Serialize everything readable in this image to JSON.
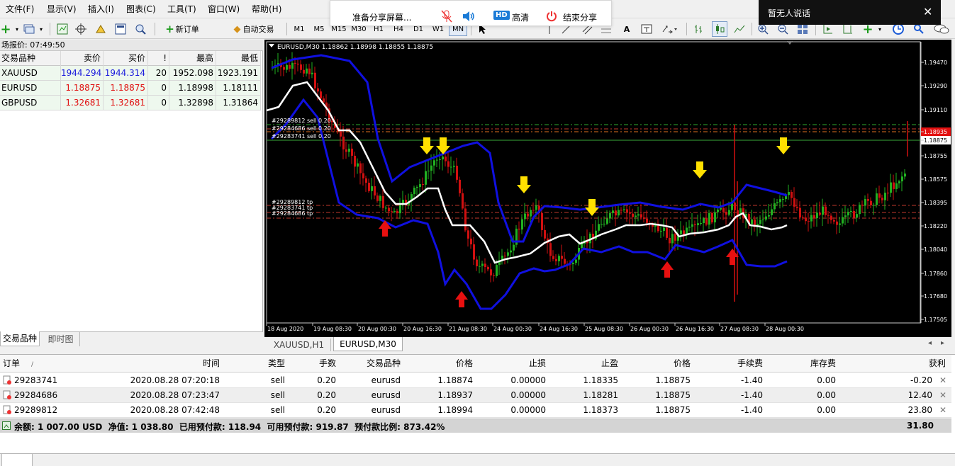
{
  "menu": {
    "file": "文件(F)",
    "view": "显示(V)",
    "insert": "插入(I)",
    "charts": "图表(C)",
    "tools": "工具(T)",
    "window": "窗口(W)",
    "help": "帮助(H)"
  },
  "toolbar": {
    "new_order": "新订单",
    "auto_trading": "自动交易",
    "timeframes": [
      "M1",
      "M5",
      "M15",
      "M30",
      "H1",
      "H4",
      "D1",
      "W1",
      "MN"
    ],
    "text_tool": "A"
  },
  "share_bar": {
    "preparing": "准备分享屏幕...",
    "hd": "HD",
    "hd_label": "高清",
    "end_share": "结束分享"
  },
  "notice": {
    "text": "暂无人说话",
    "close": "✕"
  },
  "market_watch": {
    "title": "场报价: 07:49:50",
    "headers": {
      "symbol": "交易品种",
      "bid": "卖价",
      "ask": "买价",
      "bang": "!",
      "high": "最高",
      "low": "最低"
    },
    "rows": [
      {
        "symbol": "XAUUSD",
        "bid": "1944.294",
        "ask": "1944.314",
        "spread": "20",
        "high": "1952.098",
        "low": "1923.191",
        "color": "#1a1adc"
      },
      {
        "symbol": "EURUSD",
        "bid": "1.18875",
        "ask": "1.18875",
        "spread": "0",
        "high": "1.18998",
        "low": "1.18111",
        "color": "#e01010"
      },
      {
        "symbol": "GBPUSD",
        "bid": "1.32681",
        "ask": "1.32681",
        "spread": "0",
        "high": "1.32898",
        "low": "1.31864",
        "color": "#e01010"
      }
    ],
    "tabs": {
      "symbols": "交易品种",
      "tick": "即时图"
    }
  },
  "chart": {
    "header": "EURUSD,M30  1.18862 1.18998 1.18855 1.18875",
    "order_sell_labels": [
      "#29289812 sell 0.20",
      "#29284686 sell 0.20",
      "#29283741 sell 0.20"
    ],
    "order_tp_labels": [
      "#29289812 tp",
      "#29283741 tp",
      "#29284686 tp"
    ],
    "price_ticks": [
      "1.19470",
      "1.19290",
      "1.19110",
      "1.18935",
      "1.18875",
      "1.18755",
      "1.18575",
      "1.18395",
      "1.18220",
      "1.18040",
      "1.17860",
      "1.17680",
      "1.17505"
    ],
    "bid_label": "1.18875",
    "ask_label": "1.18935",
    "time_ticks": [
      "18 Aug 2020",
      "19 Aug 08:30",
      "20 Aug 00:30",
      "20 Aug 16:30",
      "21 Aug 08:30",
      "24 Aug 00:30",
      "24 Aug 16:30",
      "25 Aug 08:30",
      "26 Aug 00:30",
      "26 Aug 16:30",
      "27 Aug 08:30",
      "28 Aug 00:30"
    ]
  },
  "chart_tabs": [
    "XAUUSD,H1",
    "EURUSD,M30"
  ],
  "terminal": {
    "headers": {
      "order": "订单",
      "sort": "/",
      "time": "时间",
      "type": "类型",
      "lots": "手数",
      "symbol": "交易品种",
      "price": "价格",
      "sl": "止损",
      "tp": "止盈",
      "cur_price": "价格",
      "commission": "手续费",
      "swap": "库存费",
      "profit": "获利"
    },
    "rows": [
      {
        "order": "29283741",
        "time": "2020.08.28 07:20:18",
        "type": "sell",
        "lots": "0.20",
        "symbol": "eurusd",
        "price": "1.18874",
        "sl": "0.00000",
        "tp": "1.18335",
        "cur": "1.18875",
        "commission": "-1.40",
        "swap": "0.00",
        "profit": "-0.20"
      },
      {
        "order": "29284686",
        "time": "2020.08.28 07:23:47",
        "type": "sell",
        "lots": "0.20",
        "symbol": "eurusd",
        "price": "1.18937",
        "sl": "0.00000",
        "tp": "1.18281",
        "cur": "1.18875",
        "commission": "-1.40",
        "swap": "0.00",
        "profit": "12.40"
      },
      {
        "order": "29289812",
        "time": "2020.08.28 07:42:48",
        "type": "sell",
        "lots": "0.20",
        "symbol": "eurusd",
        "price": "1.18994",
        "sl": "0.00000",
        "tp": "1.18373",
        "cur": "1.18875",
        "commission": "-1.40",
        "swap": "0.00",
        "profit": "23.80"
      }
    ],
    "summary": "余额: 1 007.00 USD  净值: 1 038.80  已用预付款: 118.94  可用预付款: 919.87  预付款比例: 873.42%",
    "summary_total": "31.80",
    "row_close": "✕"
  },
  "colors": {
    "bollinger": "#1010e0",
    "ma": "#ffffff",
    "bull": "#21b021",
    "bear": "#d11010",
    "buy_arrow": "#e81010",
    "sell_arrow": "#ffe000",
    "tp_line": "#c0392b",
    "order_line": "#2e8b2e"
  }
}
